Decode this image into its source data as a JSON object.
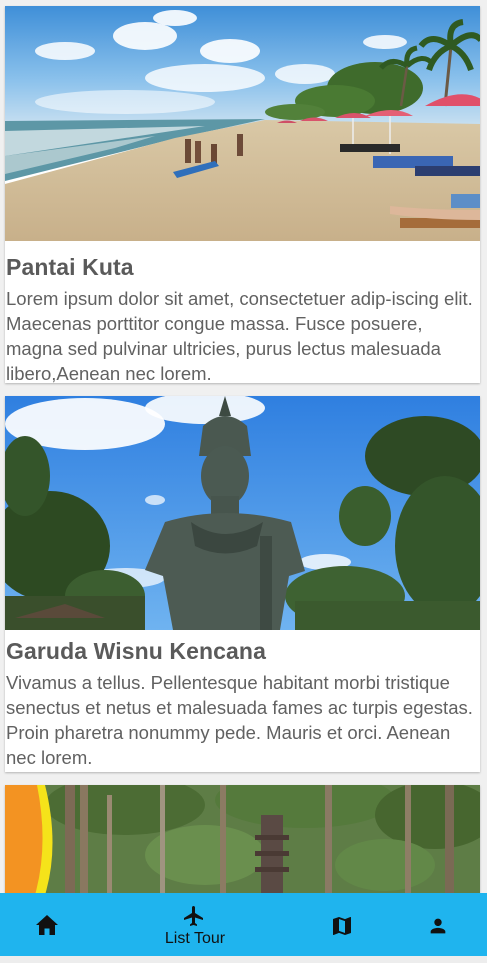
{
  "places": [
    {
      "title": "Pantai Kuta",
      "description": "Lorem ipsum dolor sit amet, consectetuer adip-iscing elit. Maecenas porttitor congue massa. Fusce posuere, magna sed pulvinar ultricies, purus lectus malesuada libero,Aenean nec lorem."
    },
    {
      "title": "Garuda Wisnu Kencana",
      "description": "Vivamus a tellus. Pellentesque habitant morbi tristique senectus et netus et malesuada fames ac turpis egestas. Proin pharetra nonummy pede. Mauris et orci. Aenean nec lorem."
    }
  ],
  "bottom_nav": {
    "items": [
      {
        "icon": "home-icon",
        "label": ""
      },
      {
        "icon": "airplane-icon",
        "label": "List Tour"
      },
      {
        "icon": "map-icon",
        "label": ""
      },
      {
        "icon": "person-icon",
        "label": ""
      }
    ]
  },
  "colors": {
    "nav_background": "#1fb4ee",
    "title_text": "#5a5a5a",
    "body_text": "#616161"
  }
}
